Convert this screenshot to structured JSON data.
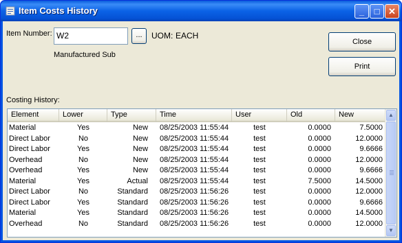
{
  "window": {
    "title": "Item Costs History"
  },
  "titlebar_buttons": {
    "minimize": "_",
    "maximize": "□",
    "close": "✕"
  },
  "item": {
    "label": "Item Number:",
    "value": "W2",
    "lookup_button": "...",
    "uom_label": "UOM:",
    "uom_value": "EACH",
    "type_text": "Manufactured Sub"
  },
  "buttons": {
    "close": "Close",
    "print": "Print"
  },
  "history": {
    "label": "Costing History:",
    "columns": [
      "Element",
      "Lower",
      "Type",
      "Time",
      "User",
      "Old",
      "New"
    ],
    "rows": [
      [
        "Material",
        "Yes",
        "New",
        "08/25/2003 11:55:44",
        "test",
        "0.0000",
        "7.5000"
      ],
      [
        "Direct Labor",
        "No",
        "New",
        "08/25/2003 11:55:44",
        "test",
        "0.0000",
        "12.0000"
      ],
      [
        "Direct Labor",
        "Yes",
        "New",
        "08/25/2003 11:55:44",
        "test",
        "0.0000",
        "9.6666"
      ],
      [
        "Overhead",
        "No",
        "New",
        "08/25/2003 11:55:44",
        "test",
        "0.0000",
        "12.0000"
      ],
      [
        "Overhead",
        "Yes",
        "New",
        "08/25/2003 11:55:44",
        "test",
        "0.0000",
        "9.6666"
      ],
      [
        "Material",
        "Yes",
        "Actual",
        "08/25/2003 11:55:44",
        "test",
        "7.5000",
        "14.5000"
      ],
      [
        "Direct Labor",
        "No",
        "Standard",
        "08/25/2003 11:56:26",
        "test",
        "0.0000",
        "12.0000"
      ],
      [
        "Direct Labor",
        "Yes",
        "Standard",
        "08/25/2003 11:56:26",
        "test",
        "0.0000",
        "9.6666"
      ],
      [
        "Material",
        "Yes",
        "Standard",
        "08/25/2003 11:56:26",
        "test",
        "0.0000",
        "14.5000"
      ],
      [
        "Overhead",
        "No",
        "Standard",
        "08/25/2003 11:56:26",
        "test",
        "0.0000",
        "12.0000"
      ]
    ]
  },
  "scrollbar": {
    "up_arrow": "▲",
    "down_arrow": "▼"
  }
}
